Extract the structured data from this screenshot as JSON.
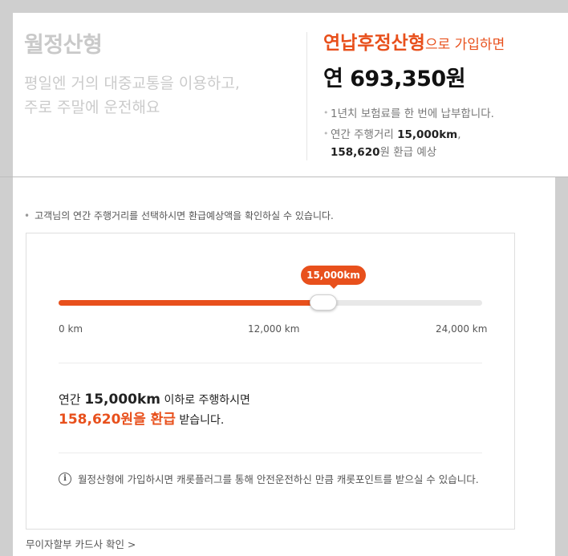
{
  "plan": {
    "name": "월정산형",
    "desc_line1": "평일엔 거의 대중교통을 이용하고,",
    "desc_line2": "주로 주말에 운전해요"
  },
  "offer": {
    "plan_name": "연납후정산형",
    "suffix": "으로 가입하면",
    "price": "연 693,350원",
    "bullet1": "1년치 보험료를 한 번에 납부합니다.",
    "bullet2_prefix": "연간 주행거리 ",
    "bullet2_km": "15,000km",
    "bullet2_suffix": ",",
    "bullet2_amount": "158,620",
    "bullet2_tail": "원 환급 예상"
  },
  "notice": "고객님의 연간 주행거리를 선택하시면 환급예상액을 확인하실 수 있습니다.",
  "slider": {
    "tooltip": "15,000km",
    "min": 0,
    "max": 24000,
    "value": 15000,
    "ticks": [
      "0 km",
      "12,000 km",
      "24,000 km"
    ],
    "accent": "#e8501c"
  },
  "result": {
    "prefix": "연간 ",
    "km": "15,000km",
    "mid": " 이하로 주행하시면",
    "amount": "158,620원을 환급",
    "tail": " 받습니다."
  },
  "info": {
    "icon": "info-icon",
    "text": "월정산형에 가입하시면 캐롯플러그를 통해 안전운전하신 만큼 캐롯포인트를 받으실 수 있습니다."
  },
  "card_link": "무이자할부 카드사 확인 >"
}
